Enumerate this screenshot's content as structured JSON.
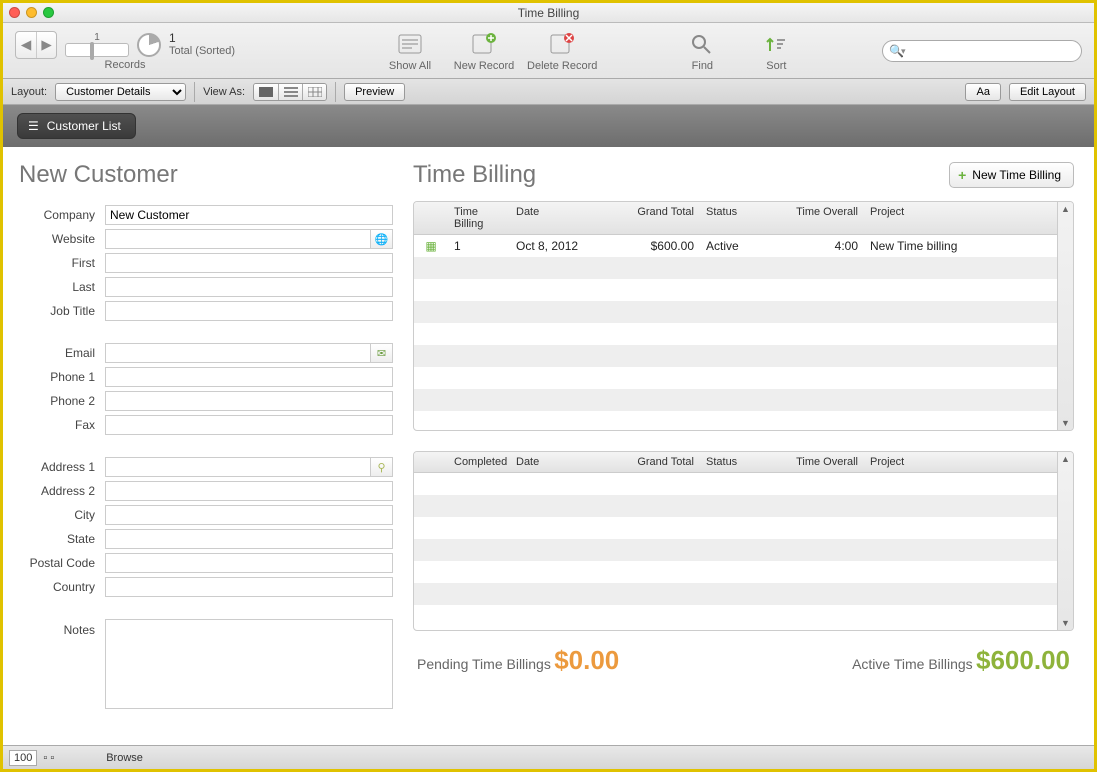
{
  "window": {
    "title": "Time Billing"
  },
  "toolbar": {
    "record_count": "1",
    "record_total": "Total (Sorted)",
    "records_label": "Records",
    "show_all": "Show All",
    "new_record": "New Record",
    "delete_record": "Delete Record",
    "find": "Find",
    "sort": "Sort",
    "slider_value": "1"
  },
  "layoutbar": {
    "layout_label": "Layout:",
    "layout_value": "Customer Details",
    "viewas_label": "View As:",
    "preview": "Preview",
    "aa": "Aa",
    "edit_layout": "Edit Layout"
  },
  "breadcrumb": {
    "customer_list": "Customer List"
  },
  "left": {
    "heading": "New Customer",
    "labels": {
      "company": "Company",
      "website": "Website",
      "first": "First",
      "last": "Last",
      "job_title": "Job Title",
      "email": "Email",
      "phone1": "Phone 1",
      "phone2": "Phone 2",
      "fax": "Fax",
      "address1": "Address 1",
      "address2": "Address 2",
      "city": "City",
      "state": "State",
      "postal": "Postal Code",
      "country": "Country",
      "notes": "Notes"
    },
    "values": {
      "company": "New Customer",
      "website": "",
      "first": "",
      "last": "",
      "job_title": "",
      "email": "",
      "phone1": "",
      "phone2": "",
      "fax": "",
      "address1": "",
      "address2": "",
      "city": "",
      "state": "",
      "postal": "",
      "country": "",
      "notes": ""
    }
  },
  "right": {
    "heading": "Time Billing",
    "new_btn": "New Time Billing",
    "table1": {
      "headers": [
        "Time Billing",
        "Date",
        "Grand Total",
        "Status",
        "Time Overall",
        "Project"
      ],
      "rows": [
        {
          "num": "1",
          "date": "Oct 8, 2012",
          "total": "$600.00",
          "status": "Active",
          "time": "4:00",
          "project": "New Time billing"
        }
      ]
    },
    "table2": {
      "headers": [
        "Completed",
        "Date",
        "Grand Total",
        "Status",
        "Time Overall",
        "Project"
      ]
    },
    "summary": {
      "pending_label": "Pending Time Billings",
      "pending_value": "$0.00",
      "active_label": "Active Time Billings",
      "active_value": "$600.00"
    }
  },
  "statusbar": {
    "zoom": "100",
    "mode": "Browse"
  }
}
